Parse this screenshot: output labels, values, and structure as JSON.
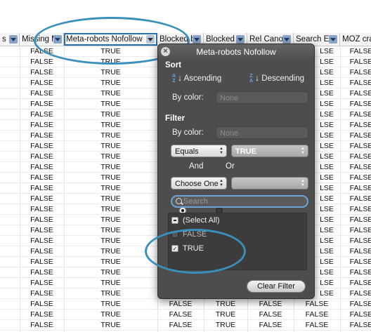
{
  "columns": [
    {
      "label": "s"
    },
    {
      "label": "Missing M"
    },
    {
      "label": "Meta-robots Nofollow"
    },
    {
      "label": "Blocked b"
    },
    {
      "label": "Blocked b"
    },
    {
      "label": "Rel Canon"
    },
    {
      "label": "Search En"
    },
    {
      "label": "MOZ cra"
    }
  ],
  "rows_top": {
    "col_missing": "FALSE",
    "col_nofollow": "TRUE",
    "col_moz": "FALSE",
    "col_search_visible": "LSE"
  },
  "rows_bottom": {
    "col_missing": "FALSE",
    "col_nofollow": "TRUE",
    "col_blocked1": "FALSE",
    "col_blocked2": "TRUE",
    "col_relcanon": "FALSE",
    "col_search": "FALSE",
    "col_moz": "FALSE"
  },
  "filter_popup": {
    "title": "Meta-robots Nofollow",
    "close_glyph": "×",
    "sort_heading": "Sort",
    "ascending_label": "Ascending",
    "descending_label": "Descending",
    "sort_by_color_label": "By color:",
    "sort_by_color_value": "None",
    "filter_heading": "Filter",
    "filter_by_color_label": "By color:",
    "filter_by_color_value": "None",
    "condition1_operator": "Equals",
    "condition1_value": "TRUE",
    "and_label": "And",
    "or_label": "Or",
    "condition2_operator": "Choose One",
    "condition2_value": "",
    "search_placeholder": "Search",
    "items": [
      {
        "label": "(Select All)",
        "state": "mixed"
      },
      {
        "label": "FALSE",
        "state": "unchecked"
      },
      {
        "label": "TRUE",
        "state": "checked"
      }
    ],
    "clear_button_label": "Clear Filter"
  },
  "colors": {
    "popup_bg": "#4d4d4d",
    "annotation_ring": "#3a8fbd",
    "selected_header_outline": "#2a6fb6"
  }
}
